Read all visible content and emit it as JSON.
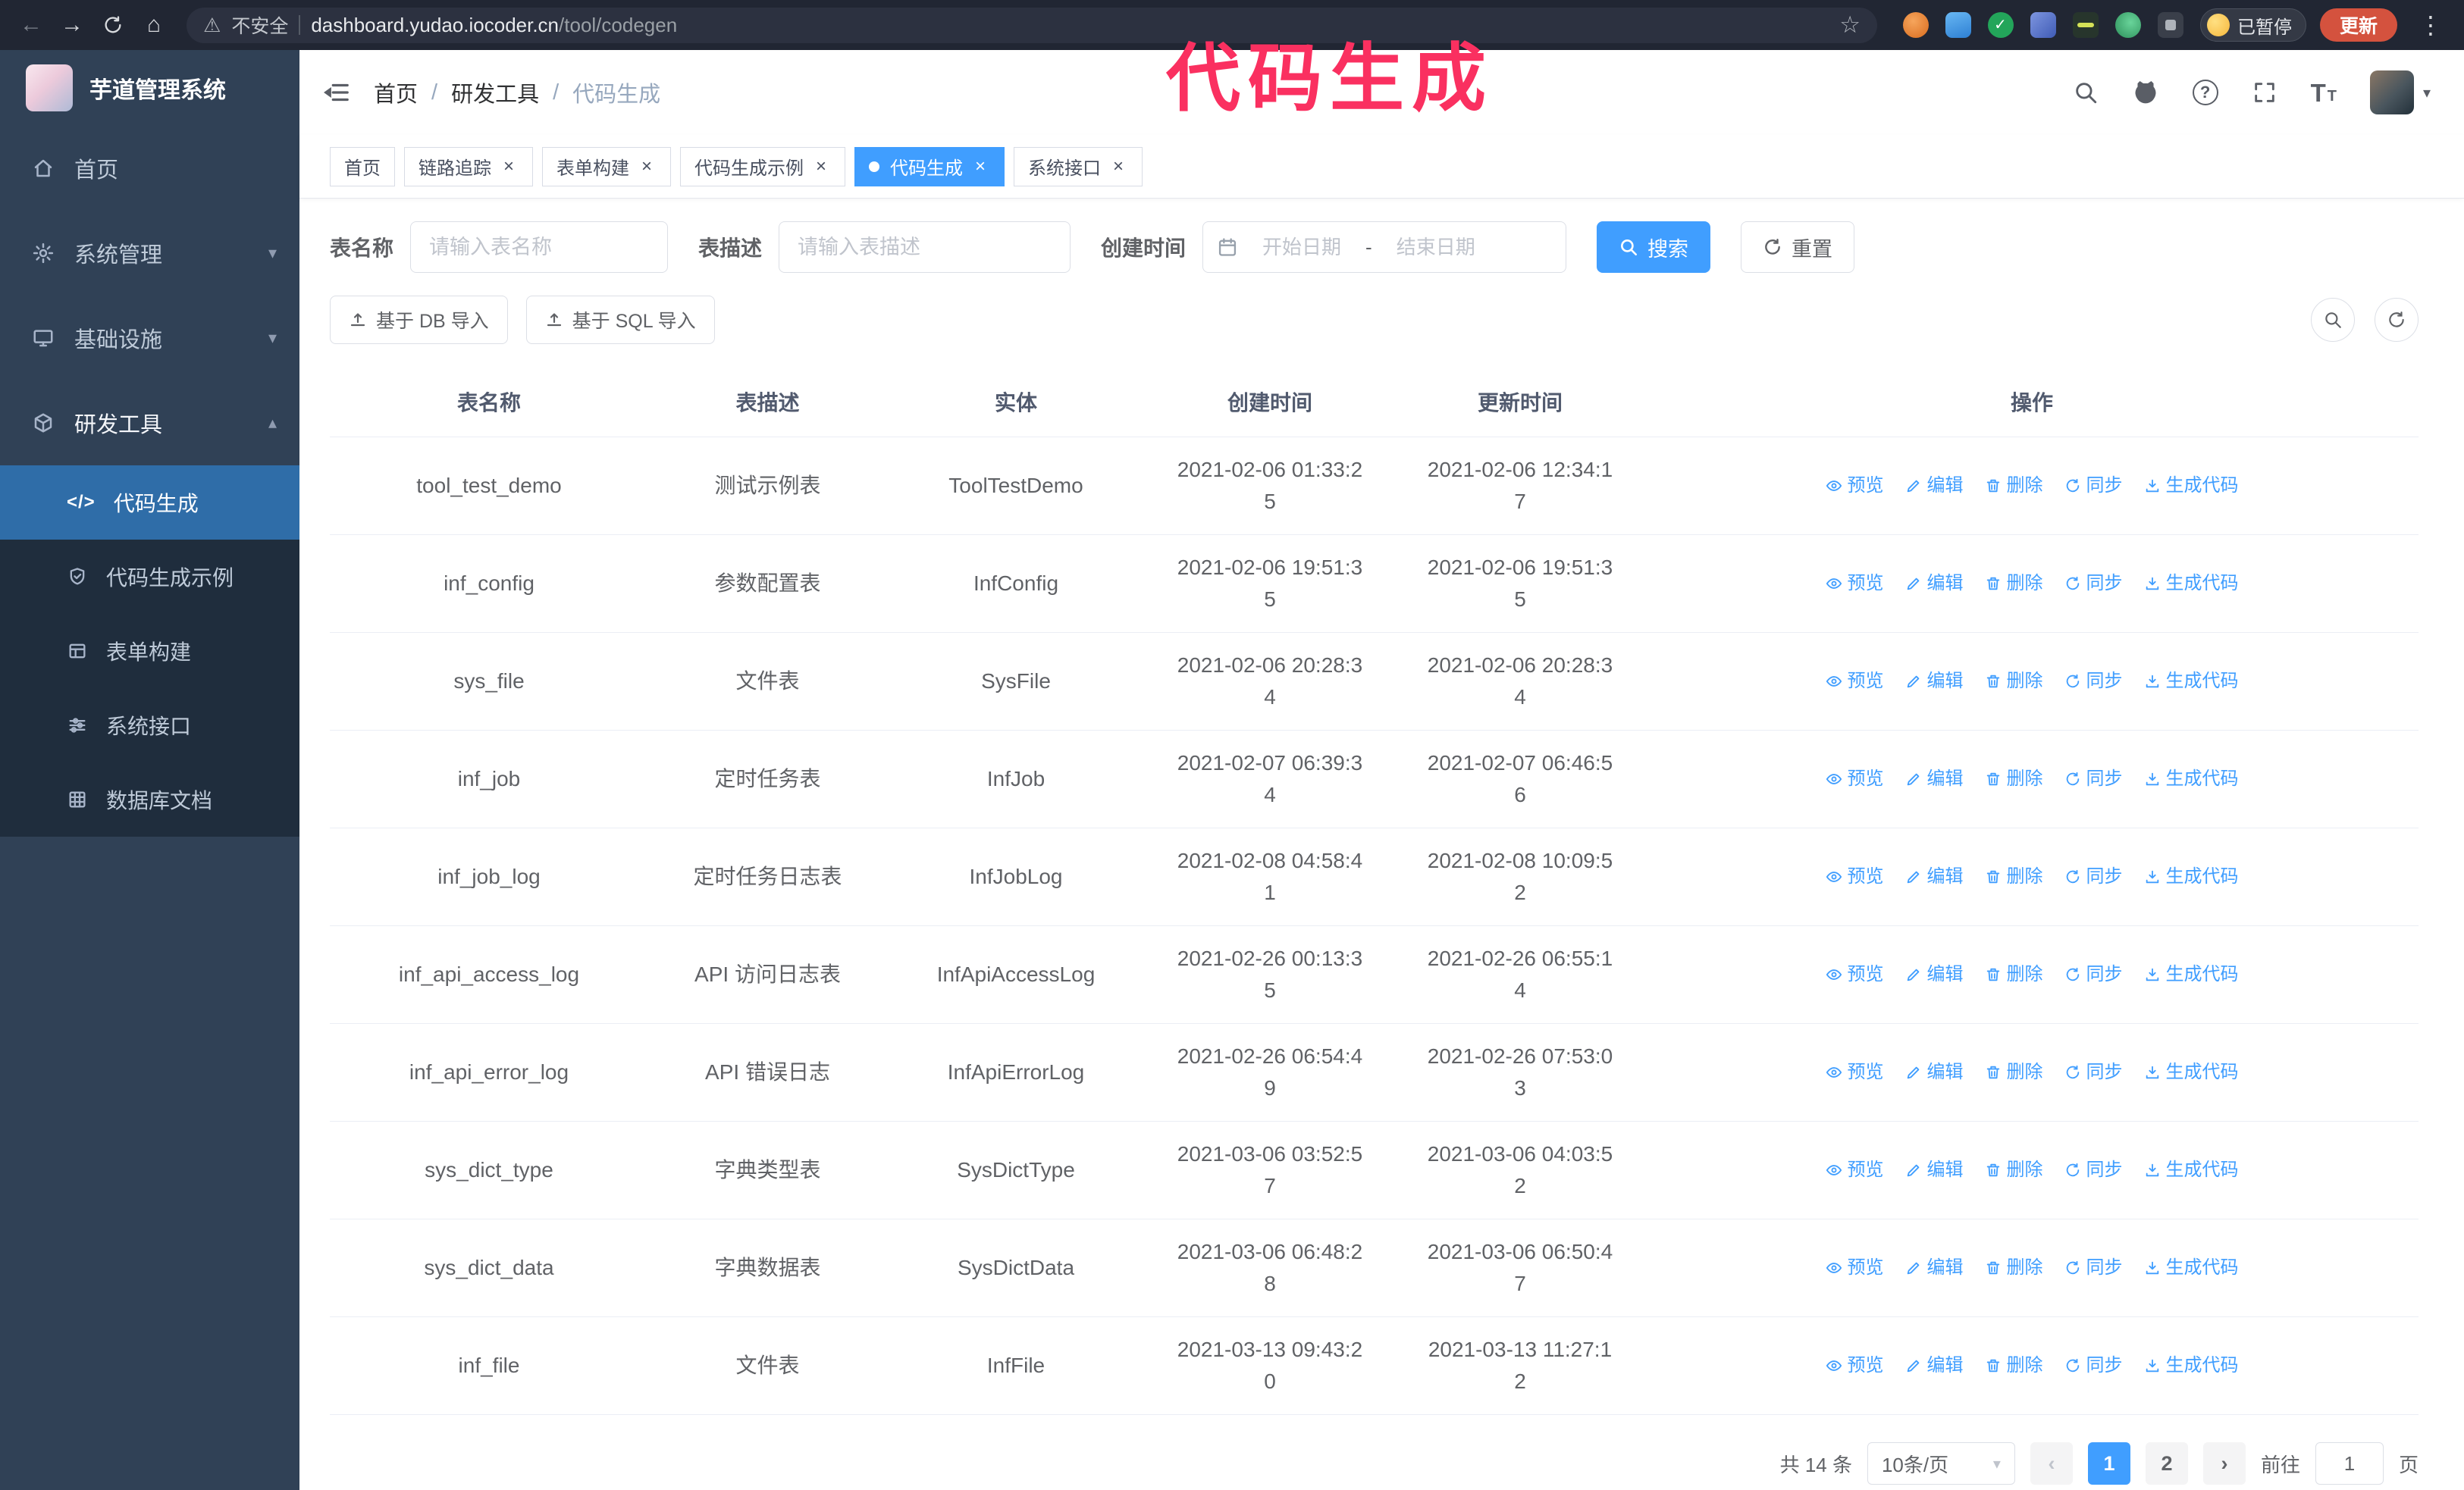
{
  "annotation": {
    "text": "代码生成",
    "color": "#fa3060"
  },
  "browser": {
    "security_label": "不安全",
    "url_domain": "dashboard.yudao.iocoder.cn",
    "url_path": "/tool/codegen",
    "paused_badge": "已暂停",
    "update_button": "更新"
  },
  "glyphs": {
    "back": "←",
    "forward": "→",
    "home": "⌂",
    "warning": "⚠",
    "star": "☆",
    "kebab": "⋮",
    "close": "×",
    "question": "?",
    "caret_down": "▾",
    "caret_up": "▴",
    "prev": "‹",
    "next": "›",
    "code": "</>",
    "font_big": "T",
    "font_small": "T"
  },
  "sidebar": {
    "app_title": "芋道管理系统",
    "items": [
      {
        "label": "首页",
        "expandable": false
      },
      {
        "label": "系统管理",
        "expandable": true
      },
      {
        "label": "基础设施",
        "expandable": true
      },
      {
        "label": "研发工具",
        "expandable": true,
        "expanded": true
      }
    ],
    "sub_items": [
      {
        "label": "代码生成",
        "active": true
      },
      {
        "label": "代码生成示例",
        "active": false
      },
      {
        "label": "表单构建",
        "active": false
      },
      {
        "label": "系统接口",
        "active": false
      },
      {
        "label": "数据库文档",
        "active": false
      }
    ]
  },
  "header": {
    "breadcrumb": [
      "首页",
      "研发工具",
      "代码生成"
    ],
    "separator": "/"
  },
  "tabs": [
    {
      "label": "首页",
      "closable": false,
      "active": false
    },
    {
      "label": "链路追踪",
      "closable": true,
      "active": false
    },
    {
      "label": "表单构建",
      "closable": true,
      "active": false
    },
    {
      "label": "代码生成示例",
      "closable": true,
      "active": false
    },
    {
      "label": "代码生成",
      "closable": true,
      "active": true
    },
    {
      "label": "系统接口",
      "closable": true,
      "active": false
    }
  ],
  "filters": {
    "table_name_label": "表名称",
    "table_name_placeholder": "请输入表名称",
    "table_desc_label": "表描述",
    "table_desc_placeholder": "请输入表描述",
    "create_time_label": "创建时间",
    "date_start_placeholder": "开始日期",
    "date_separator": "-",
    "date_end_placeholder": "结束日期",
    "search_button": "搜索",
    "reset_button": "重置"
  },
  "toolbar": {
    "import_db_button": "基于 DB 导入",
    "import_sql_button": "基于 SQL 导入"
  },
  "table": {
    "columns": [
      "表名称",
      "表描述",
      "实体",
      "创建时间",
      "更新时间",
      "操作"
    ],
    "ops": [
      "预览",
      "编辑",
      "删除",
      "同步",
      "生成代码"
    ],
    "rows": [
      {
        "name": "tool_test_demo",
        "desc": "测试示例表",
        "entity": "ToolTestDemo",
        "created": "2021-02-06 01:33:25",
        "updated": "2021-02-06 12:34:17"
      },
      {
        "name": "inf_config",
        "desc": "参数配置表",
        "entity": "InfConfig",
        "created": "2021-02-06 19:51:35",
        "updated": "2021-02-06 19:51:35"
      },
      {
        "name": "sys_file",
        "desc": "文件表",
        "entity": "SysFile",
        "created": "2021-02-06 20:28:34",
        "updated": "2021-02-06 20:28:34"
      },
      {
        "name": "inf_job",
        "desc": "定时任务表",
        "entity": "InfJob",
        "created": "2021-02-07 06:39:34",
        "updated": "2021-02-07 06:46:56"
      },
      {
        "name": "inf_job_log",
        "desc": "定时任务日志表",
        "entity": "InfJobLog",
        "created": "2021-02-08 04:58:41",
        "updated": "2021-02-08 10:09:52"
      },
      {
        "name": "inf_api_access_log",
        "desc": "API 访问日志表",
        "entity": "InfApiAccessLog",
        "created": "2021-02-26 00:13:35",
        "updated": "2021-02-26 06:55:14"
      },
      {
        "name": "inf_api_error_log",
        "desc": "API 错误日志",
        "entity": "InfApiErrorLog",
        "created": "2021-02-26 06:54:49",
        "updated": "2021-02-26 07:53:03"
      },
      {
        "name": "sys_dict_type",
        "desc": "字典类型表",
        "entity": "SysDictType",
        "created": "2021-03-06 03:52:57",
        "updated": "2021-03-06 04:03:52"
      },
      {
        "name": "sys_dict_data",
        "desc": "字典数据表",
        "entity": "SysDictData",
        "created": "2021-03-06 06:48:28",
        "updated": "2021-03-06 06:50:47"
      },
      {
        "name": "inf_file",
        "desc": "文件表",
        "entity": "InfFile",
        "created": "2021-03-13 09:43:20",
        "updated": "2021-03-13 11:27:12"
      }
    ]
  },
  "pagination": {
    "total": "共 14 条",
    "page_size": "10条/页",
    "pages": [
      "1",
      "2"
    ],
    "active_page": "1",
    "goto_label": "前往",
    "goto_value": "1",
    "goto_unit": "页"
  }
}
